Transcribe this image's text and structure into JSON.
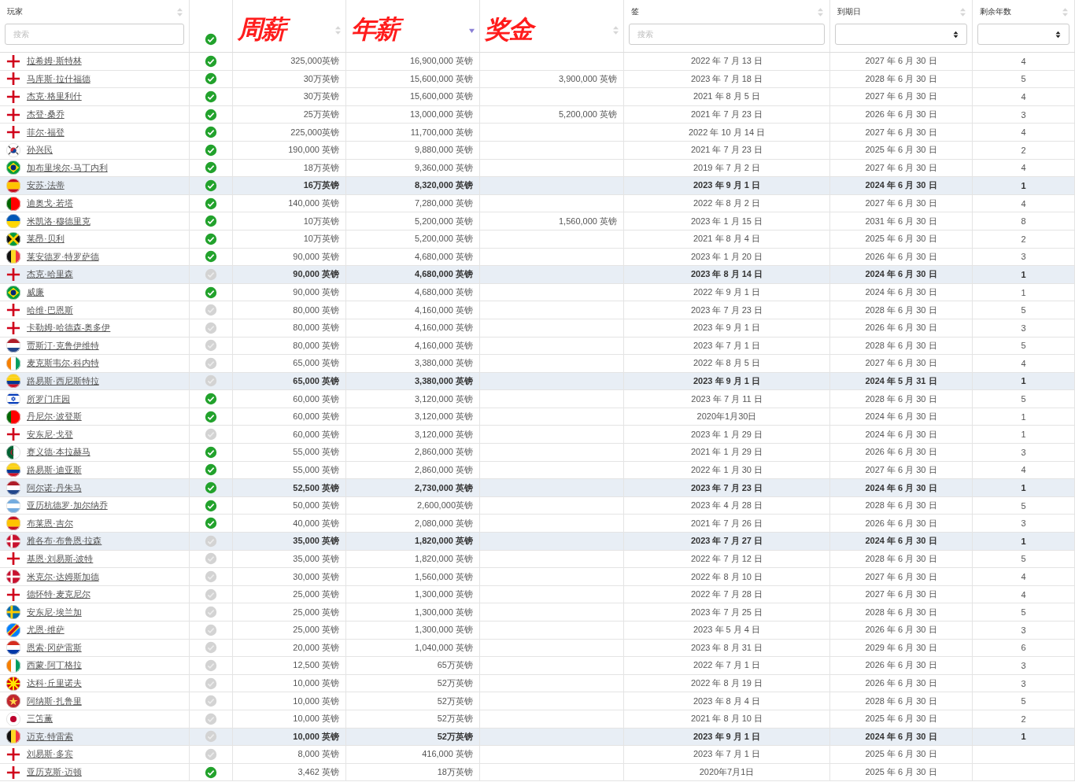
{
  "header": [
    {
      "kind": "label",
      "label": "玩家",
      "sorted": false,
      "filter": {
        "kind": "search",
        "placeholder": "搜索"
      }
    },
    {
      "kind": "check",
      "checked": true
    },
    {
      "kind": "annotation",
      "label": "周薪",
      "sorted": false
    },
    {
      "kind": "annotation",
      "label": "年薪",
      "sorted": true
    },
    {
      "kind": "annotation",
      "label": "奖金",
      "sorted": false
    },
    {
      "kind": "label",
      "label": "签",
      "sorted": false,
      "filter": {
        "kind": "search",
        "placeholder": "搜索"
      }
    },
    {
      "kind": "label",
      "label": "到期日",
      "sorted": false,
      "filter": {
        "kind": "select"
      }
    },
    {
      "kind": "label",
      "label": "剩余年数",
      "sorted": false,
      "filter": {
        "kind": "select"
      }
    }
  ],
  "rows": [
    {
      "kind": "england",
      "name": "拉希姆·斯特林",
      "checked": true,
      "weekly": "325,000英镑",
      "annual": "16,900,000 英镑",
      "signed": "2022 年 7 月 13 日",
      "expiry": "2027 年 6 月 30 日",
      "years": "4",
      "highlighted": false
    },
    {
      "kind": "england",
      "name": "马库斯·拉什福德",
      "checked": true,
      "weekly": "30万英镑",
      "annual": "15,600,000 英镑",
      "bonus": "3,900,000 英镑",
      "signed": "2023 年 7 月 18 日",
      "expiry": "2028 年 6 月 30 日",
      "years": "5",
      "highlighted": false
    },
    {
      "kind": "england",
      "name": "杰克·格里利什",
      "checked": true,
      "weekly": "30万英镑",
      "annual": "15,600,000 英镑",
      "signed": "2021 年 8 月 5 日",
      "expiry": "2027 年 6 月 30 日",
      "years": "4",
      "highlighted": false
    },
    {
      "kind": "england",
      "name": "杰登·桑乔",
      "checked": true,
      "weekly": "25万英镑",
      "annual": "13,000,000 英镑",
      "bonus": "5,200,000 英镑",
      "signed": "2021 年 7 月 23 日",
      "expiry": "2026 年 6 月 30 日",
      "years": "3",
      "highlighted": false
    },
    {
      "kind": "england",
      "name": "菲尔·福登",
      "checked": true,
      "weekly": "225,000英镑",
      "annual": "11,700,000 英镑",
      "signed": "2022 年 10 月 14 日",
      "expiry": "2027 年 6 月 30 日",
      "years": "4",
      "highlighted": false
    },
    {
      "kind": "korea",
      "name": "孙兴民",
      "checked": true,
      "weekly": "190,000 英镑",
      "annual": "9,880,000 英镑",
      "signed": "2021 年 7 月 23 日",
      "expiry": "2025 年 6 月 30 日",
      "years": "2",
      "highlighted": false
    },
    {
      "kind": "brazil",
      "name": "加布里埃尔·马丁内利",
      "checked": true,
      "weekly": "18万英镑",
      "annual": "9,360,000 英镑",
      "signed": "2019 年 7 月 2 日",
      "expiry": "2027 年 6 月 30 日",
      "years": "4",
      "highlighted": false
    },
    {
      "kind": "spain",
      "name": "安苏·法蒂",
      "checked": true,
      "weekly": "16万英镑",
      "annual": "8,320,000 英镑",
      "signed": "2023 年 9 月 1 日",
      "expiry": "2024 年 6 月 30 日",
      "years": "1",
      "highlighted": true
    },
    {
      "kind": "portugal",
      "name": "迪奥戈·若塔",
      "checked": true,
      "weekly": "140,000 英镑",
      "annual": "7,280,000 英镑",
      "signed": "2022 年 8 月 2 日",
      "expiry": "2027 年 6 月 30 日",
      "years": "4",
      "highlighted": false
    },
    {
      "kind": "ukraine",
      "name": "米凯洛·穆德里克",
      "checked": true,
      "weekly": "10万英镑",
      "annual": "5,200,000 英镑",
      "bonus": "1,560,000 英镑",
      "signed": "2023 年 1 月 15 日",
      "expiry": "2031 年 6 月 30 日",
      "years": "8",
      "highlighted": false
    },
    {
      "kind": "jamaica",
      "name": "莱昂·贝利",
      "checked": true,
      "weekly": "10万英镑",
      "annual": "5,200,000 英镑",
      "signed": "2021 年 8 月 4 日",
      "expiry": "2025 年 6 月 30 日",
      "years": "2",
      "highlighted": false
    },
    {
      "kind": "belgium",
      "name": "莱安德罗·特罗萨德",
      "checked": true,
      "weekly": "90,000 英镑",
      "annual": "4,680,000 英镑",
      "signed": "2023 年 1 月 20 日",
      "expiry": "2026 年 6 月 30 日",
      "years": "3",
      "highlighted": false
    },
    {
      "kind": "england",
      "name": "杰克·哈里森",
      "checked": false,
      "weekly": "90,000 英镑",
      "annual": "4,680,000 英镑",
      "signed": "2023 年 8 月 14 日",
      "expiry": "2024 年 6 月 30 日",
      "years": "1",
      "highlighted": true
    },
    {
      "kind": "brazil",
      "name": "威廉",
      "checked": true,
      "weekly": "90,000 英镑",
      "annual": "4,680,000 英镑",
      "signed": "2022 年 9 月 1 日",
      "expiry": "2024 年 6 月 30 日",
      "years": "1",
      "highlighted": false
    },
    {
      "kind": "england",
      "name": "哈维·巴恩斯",
      "checked": false,
      "weekly": "80,000 英镑",
      "annual": "4,160,000 英镑",
      "signed": "2023 年 7 月 23 日",
      "expiry": "2028 年 6 月 30 日",
      "years": "5",
      "highlighted": false
    },
    {
      "kind": "england",
      "name": "卡勒姆·哈德森-奥多伊",
      "checked": false,
      "weekly": "80,000 英镑",
      "annual": "4,160,000 英镑",
      "signed": "2023 年 9 月 1 日",
      "expiry": "2026 年 6 月 30 日",
      "years": "3",
      "highlighted": false
    },
    {
      "kind": "netherlands",
      "name": "贾斯汀·克鲁伊维特",
      "checked": false,
      "weekly": "80,000 英镑",
      "annual": "4,160,000 英镑",
      "signed": "2023 年 7 月 1 日",
      "expiry": "2028 年 6 月 30 日",
      "years": "5",
      "highlighted": false
    },
    {
      "kind": "ivory",
      "name": "麦克斯韦尔·科内特",
      "checked": false,
      "weekly": "65,000 英镑",
      "annual": "3,380,000 英镑",
      "signed": "2022 年 8 月 5 日",
      "expiry": "2027 年 6 月 30 日",
      "years": "4",
      "highlighted": false
    },
    {
      "kind": "colombia",
      "name": "路易斯·西尼斯特拉",
      "checked": false,
      "weekly": "65,000 英镑",
      "annual": "3,380,000 英镑",
      "signed": "2023 年 9 月 1 日",
      "expiry": "2024 年 5 月 31 日",
      "years": "1",
      "highlighted": true
    },
    {
      "kind": "israel",
      "name": "所罗门庄园",
      "checked": true,
      "weekly": "60,000 英镑",
      "annual": "3,120,000 英镑",
      "signed": "2023 年 7 月 11 日",
      "expiry": "2028 年 6 月 30 日",
      "years": "5",
      "highlighted": false
    },
    {
      "kind": "portugal",
      "name": "丹尼尔·波登斯",
      "checked": true,
      "weekly": "60,000 英镑",
      "annual": "3,120,000 英镑",
      "signed": "2020年1月30日",
      "expiry": "2024 年 6 月 30 日",
      "years": "1",
      "highlighted": false
    },
    {
      "kind": "england",
      "name": "安东尼·戈登",
      "checked": false,
      "weekly": "60,000 英镑",
      "annual": "3,120,000 英镑",
      "signed": "2023 年 1 月 29 日",
      "expiry": "2024 年 6 月 30 日",
      "years": "1",
      "highlighted": false
    },
    {
      "kind": "algeria",
      "name": "赛义德·本拉赫马",
      "checked": true,
      "weekly": "55,000 英镑",
      "annual": "2,860,000 英镑",
      "signed": "2021 年 1 月 29 日",
      "expiry": "2026 年 6 月 30 日",
      "years": "3",
      "highlighted": false
    },
    {
      "kind": "colombia",
      "name": "路易斯·迪亚斯",
      "checked": true,
      "weekly": "55,000 英镑",
      "annual": "2,860,000 英镑",
      "signed": "2022 年 1 月 30 日",
      "expiry": "2027 年 6 月 30 日",
      "years": "4",
      "highlighted": false
    },
    {
      "kind": "netherlands",
      "name": "阿尔诺·丹朱马",
      "checked": true,
      "weekly": "52,500 英镑",
      "annual": "2,730,000 英镑",
      "signed": "2023 年 7 月 23 日",
      "expiry": "2024 年 6 月 30 日",
      "years": "1",
      "highlighted": true
    },
    {
      "kind": "argentina",
      "name": "亚历杭德罗·加尔纳乔",
      "checked": true,
      "weekly": "50,000 英镑",
      "annual": "2,600,000英镑",
      "signed": "2023 年 4 月 28 日",
      "expiry": "2028 年 6 月 30 日",
      "years": "5",
      "highlighted": false
    },
    {
      "kind": "spain",
      "name": "布莱恩·吉尔",
      "checked": true,
      "weekly": "40,000 英镑",
      "annual": "2,080,000 英镑",
      "signed": "2021 年 7 月 26 日",
      "expiry": "2026 年 6 月 30 日",
      "years": "3",
      "highlighted": false
    },
    {
      "kind": "denmark",
      "name": "雅各布·布鲁恩·拉森",
      "checked": false,
      "weekly": "35,000 英镑",
      "annual": "1,820,000 英镑",
      "signed": "2023 年 7 月 27 日",
      "expiry": "2024 年 6 月 30 日",
      "years": "1",
      "highlighted": true
    },
    {
      "kind": "england",
      "name": "基恩·刘易斯-波特",
      "checked": false,
      "weekly": "35,000 英镑",
      "annual": "1,820,000 英镑",
      "signed": "2022 年 7 月 12 日",
      "expiry": "2028 年 6 月 30 日",
      "years": "5",
      "highlighted": false
    },
    {
      "kind": "denmark",
      "name": "米克尔·达姆斯加德",
      "checked": false,
      "weekly": "30,000 英镑",
      "annual": "1,560,000 英镑",
      "signed": "2022 年 8 月 10 日",
      "expiry": "2027 年 6 月 30 日",
      "years": "4",
      "highlighted": false
    },
    {
      "kind": "england",
      "name": "德怀特·麦克尼尔",
      "checked": false,
      "weekly": "25,000 英镑",
      "annual": "1,300,000 英镑",
      "signed": "2022 年 7 月 28 日",
      "expiry": "2027 年 6 月 30 日",
      "years": "4",
      "highlighted": false
    },
    {
      "kind": "sweden",
      "name": "安东尼·埃兰加",
      "checked": false,
      "weekly": "25,000 英镑",
      "annual": "1,300,000 英镑",
      "signed": "2023 年 7 月 25 日",
      "expiry": "2028 年 6 月 30 日",
      "years": "5",
      "highlighted": false
    },
    {
      "kind": "drcongo",
      "name": "尤恩·维萨",
      "checked": false,
      "weekly": "25,000 英镑",
      "annual": "1,300,000 英镑",
      "signed": "2023 年 5 月 4 日",
      "expiry": "2026 年 6 月 30 日",
      "years": "3",
      "highlighted": false
    },
    {
      "kind": "paraguay",
      "name": "恩索·冈萨雷斯",
      "checked": false,
      "weekly": "20,000 英镑",
      "annual": "1,040,000 英镑",
      "signed": "2023 年 8 月 31 日",
      "expiry": "2029 年 6 月 30 日",
      "years": "6",
      "highlighted": false
    },
    {
      "kind": "ivory",
      "name": "西蒙·阿丁格拉",
      "checked": false,
      "weekly": "12,500 英镑",
      "annual": "65万英镑",
      "signed": "2022 年 7 月 1 日",
      "expiry": "2026 年 6 月 30 日",
      "years": "3",
      "highlighted": false
    },
    {
      "kind": "macedonia",
      "name": "达科·丘里诺夫",
      "checked": false,
      "weekly": "10,000 英镑",
      "annual": "52万英镑",
      "signed": "2022 年 8 月 19 日",
      "expiry": "2026 年 6 月 30 日",
      "years": "3",
      "highlighted": false
    },
    {
      "kind": "morocco",
      "name": "阿纳斯·扎鲁里",
      "checked": false,
      "weekly": "10,000 英镑",
      "annual": "52万英镑",
      "signed": "2023 年 8 月 4 日",
      "expiry": "2028 年 6 月 30 日",
      "years": "5",
      "highlighted": false
    },
    {
      "kind": "japan",
      "name": "三笘薫",
      "checked": false,
      "weekly": "10,000 英镑",
      "annual": "52万英镑",
      "signed": "2021 年 8 月 10 日",
      "expiry": "2025 年 6 月 30 日",
      "years": "2",
      "highlighted": false
    },
    {
      "kind": "belgium",
      "name": "迈克·特雷索",
      "checked": false,
      "weekly": "10,000 英镑",
      "annual": "52万英镑",
      "signed": "2023 年 9 月 1 日",
      "expiry": "2024 年 6 月 30 日",
      "years": "1",
      "highlighted": true
    },
    {
      "kind": "england",
      "name": "刘易斯·多宾",
      "checked": false,
      "weekly": "8,000 英镑",
      "annual": "416,000 英镑",
      "signed": "2023 年 7 月 1 日",
      "expiry": "2025 年 6 月 30 日",
      "highlighted": false
    },
    {
      "kind": "england",
      "name": "亚历克斯·迈顿",
      "checked": true,
      "weekly": "3,462 英镑",
      "annual": "18万英镑",
      "signed": "2020年7月1日",
      "expiry": "2025 年 6 月 30 日",
      "highlighted": false
    }
  ]
}
